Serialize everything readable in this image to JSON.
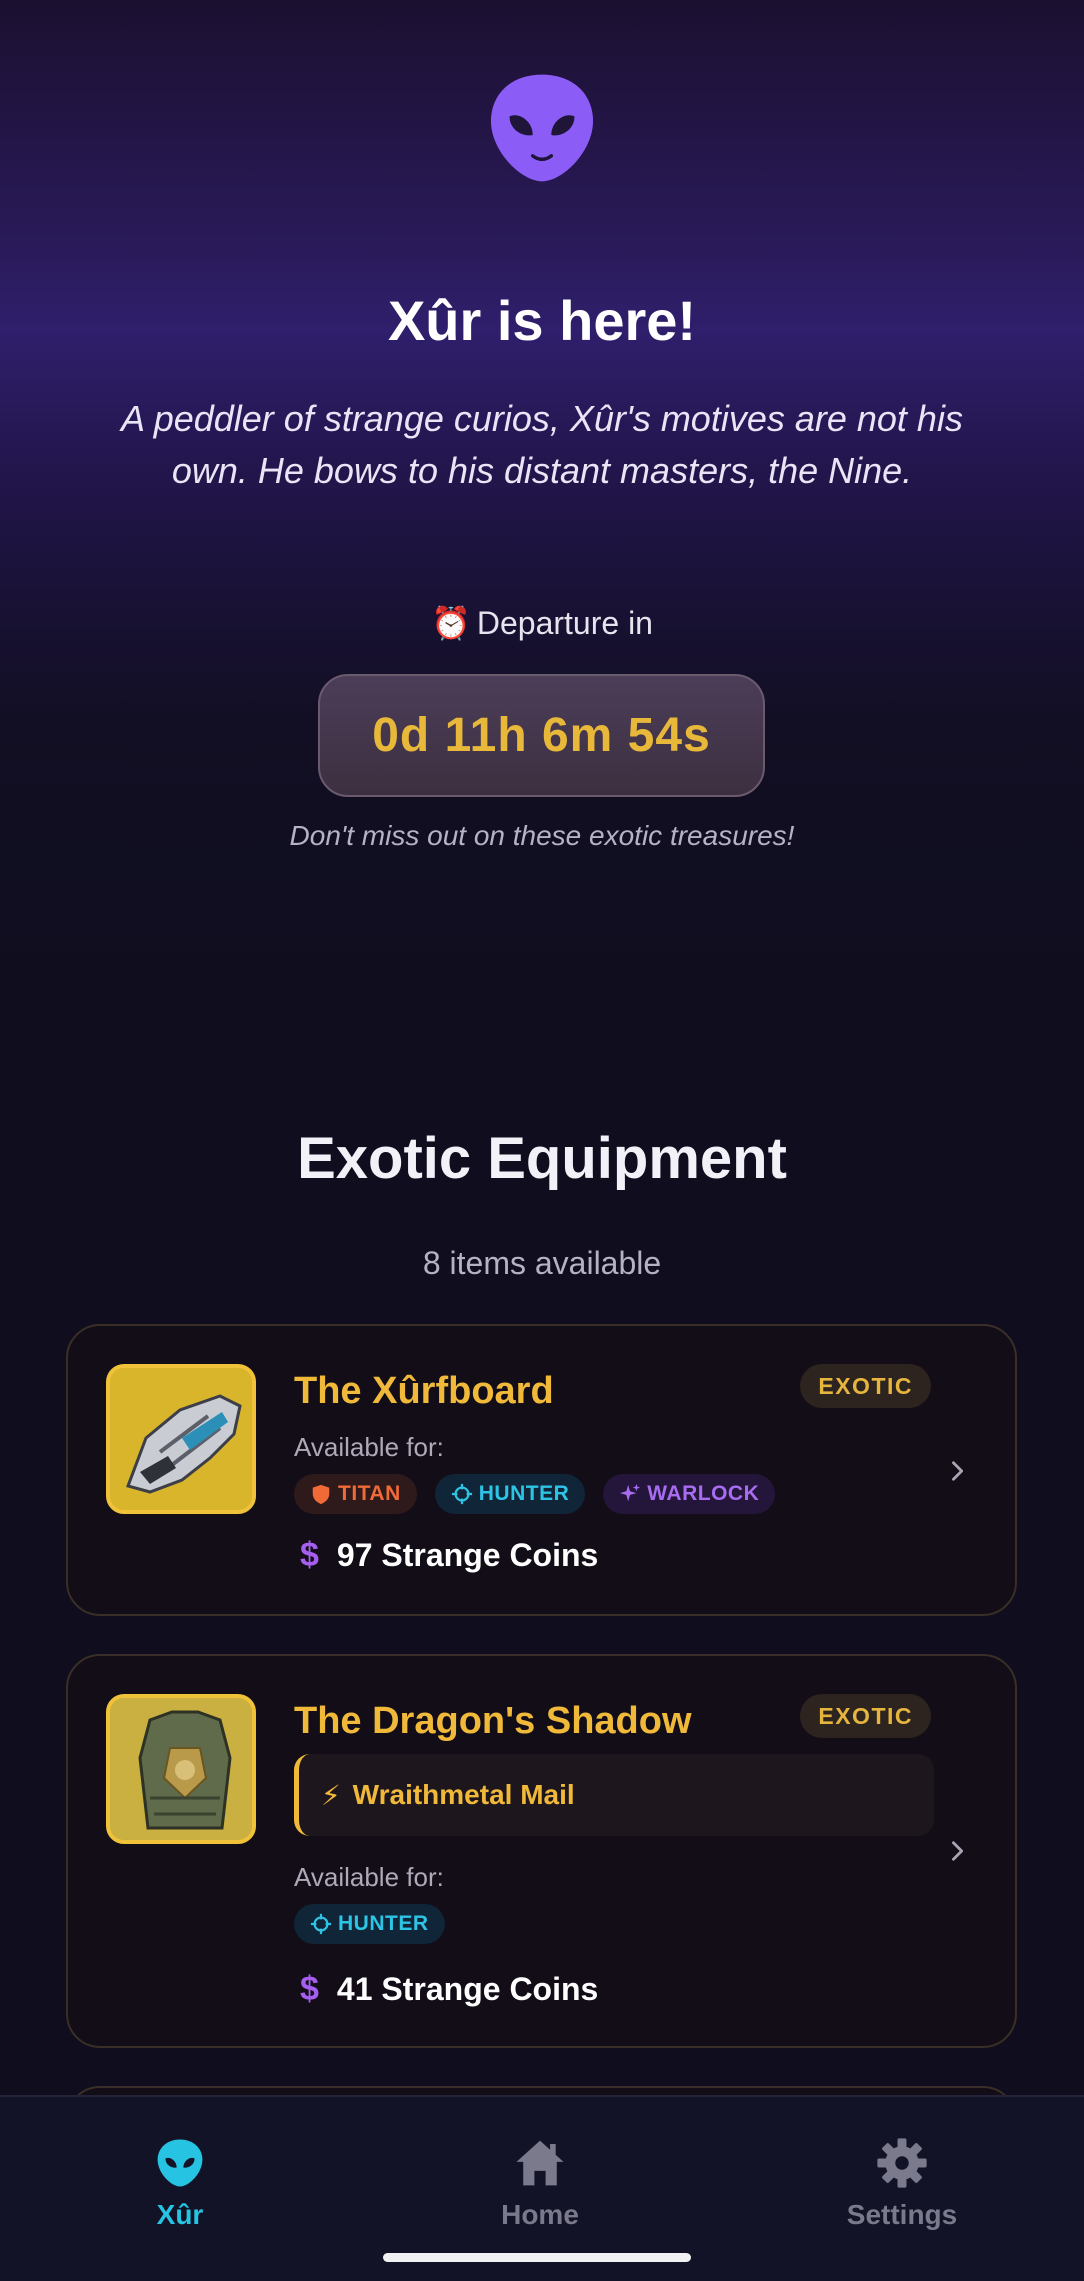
{
  "hero": {
    "logo_icon": "alien-icon",
    "title": "Xûr is here!",
    "description": "A peddler of strange curios, Xûr's motives are not his own. He bows to his distant masters, the Nine.",
    "departure_icon": "⏰",
    "departure_label": "Departure in",
    "countdown": "0d 11h 6m 54s",
    "note": "Don't miss out on these exotic treasures!"
  },
  "section": {
    "title": "Exotic Equipment",
    "count_text": "8 items available"
  },
  "items": [
    {
      "name": "The Xûrfboard",
      "badge": "EXOTIC",
      "available_label": "Available for:",
      "classes": [
        "TITAN",
        "HUNTER",
        "WARLOCK"
      ],
      "price_symbol": "$",
      "price": "97 Strange Coins"
    },
    {
      "name": "The Dragon's Shadow",
      "badge": "EXOTIC",
      "perk_icon": "⚡",
      "perk": "Wraithmetal Mail",
      "available_label": "Available for:",
      "classes": [
        "HUNTER"
      ],
      "price_symbol": "$",
      "price": "41 Strange Coins"
    }
  ],
  "nav": {
    "xur_label": "Xûr",
    "home_label": "Home",
    "settings_label": "Settings"
  },
  "colors": {
    "accent_gold": "#f1b93a",
    "hunter_cyan": "#2ec4e6",
    "titan_orange": "#ef6a37",
    "warlock_purple": "#a86cf0",
    "logo_purple": "#8b5cf6"
  }
}
